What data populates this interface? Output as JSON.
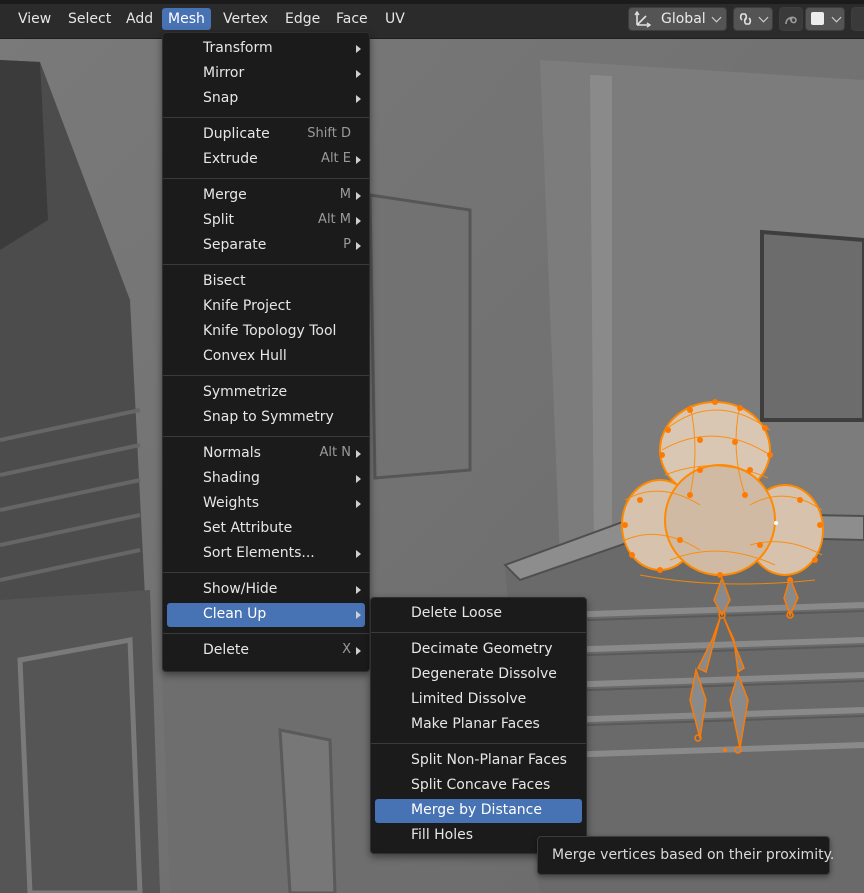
{
  "header": {
    "menus": [
      "View",
      "Select",
      "Add",
      "Mesh",
      "Vertex",
      "Edge",
      "Face",
      "UV"
    ],
    "active_menu": "Mesh",
    "transform_orientation": "Global",
    "icons": [
      "transform-pivot-icon",
      "snapping-link-icon",
      "proportional-edit-icon",
      "color-swatch-icon"
    ]
  },
  "mesh_menu": {
    "groups": [
      [
        {
          "label": "Transform",
          "shortcut": "",
          "submenu": true
        },
        {
          "label": "Mirror",
          "shortcut": "",
          "submenu": true
        },
        {
          "label": "Snap",
          "shortcut": "",
          "submenu": true
        }
      ],
      [
        {
          "label": "Duplicate",
          "shortcut": "Shift D",
          "submenu": false
        },
        {
          "label": "Extrude",
          "shortcut": "Alt E",
          "submenu": true
        }
      ],
      [
        {
          "label": "Merge",
          "shortcut": "M",
          "submenu": true
        },
        {
          "label": "Split",
          "shortcut": "Alt M",
          "submenu": true
        },
        {
          "label": "Separate",
          "shortcut": "P",
          "submenu": true
        }
      ],
      [
        {
          "label": "Bisect",
          "shortcut": "",
          "submenu": false
        },
        {
          "label": "Knife Project",
          "shortcut": "",
          "submenu": false
        },
        {
          "label": "Knife Topology Tool",
          "shortcut": "",
          "submenu": false
        },
        {
          "label": "Convex Hull",
          "shortcut": "",
          "submenu": false
        }
      ],
      [
        {
          "label": "Symmetrize",
          "shortcut": "",
          "submenu": false
        },
        {
          "label": "Snap to Symmetry",
          "shortcut": "",
          "submenu": false
        }
      ],
      [
        {
          "label": "Normals",
          "shortcut": "Alt N",
          "submenu": true
        },
        {
          "label": "Shading",
          "shortcut": "",
          "submenu": true
        },
        {
          "label": "Weights",
          "shortcut": "",
          "submenu": true
        },
        {
          "label": "Set Attribute",
          "shortcut": "",
          "submenu": false
        },
        {
          "label": "Sort Elements...",
          "shortcut": "",
          "submenu": true
        }
      ],
      [
        {
          "label": "Show/Hide",
          "shortcut": "",
          "submenu": true
        },
        {
          "label": "Clean Up",
          "shortcut": "",
          "submenu": true,
          "highlighted": true
        }
      ],
      [
        {
          "label": "Delete",
          "shortcut": "X",
          "submenu": true
        }
      ]
    ]
  },
  "cleanup_menu": {
    "groups": [
      [
        {
          "label": "Delete Loose"
        }
      ],
      [
        {
          "label": "Decimate Geometry"
        },
        {
          "label": "Degenerate Dissolve"
        },
        {
          "label": "Limited Dissolve"
        },
        {
          "label": "Make Planar Faces"
        }
      ],
      [
        {
          "label": "Split Non-Planar Faces"
        },
        {
          "label": "Split Concave Faces"
        },
        {
          "label": "Merge by Distance",
          "highlighted": true
        },
        {
          "label": "Fill Holes"
        }
      ]
    ]
  },
  "tooltip": {
    "text": "Merge vertices based on their proximity."
  },
  "colors": {
    "highlight": "#4772b3",
    "menu_bg": "#1b1b1b",
    "header_bg": "#2b2b2b",
    "selection_orange": "#ff8a00"
  }
}
